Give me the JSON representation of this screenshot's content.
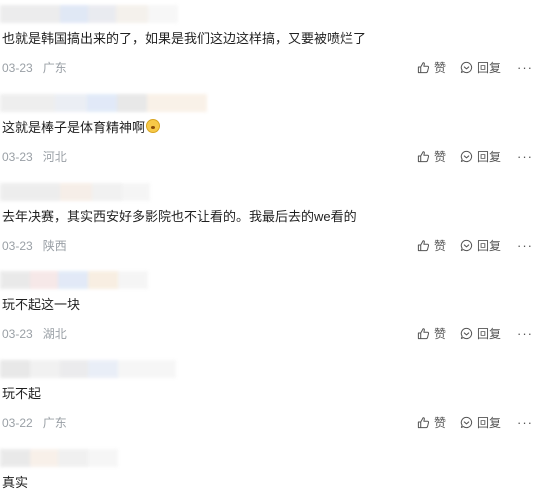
{
  "actions": {
    "like_label": "赞",
    "reply_label": "回复",
    "more_label": "···"
  },
  "comments": [
    {
      "text": "也就是韩国搞出来的了，如果是我们这边这样搞，又要被喷烂了",
      "date": "03-23",
      "location": "广东"
    },
    {
      "text": "这就是棒子是体育精神啊",
      "emoji": "astonished-face-emoji",
      "date": "03-23",
      "location": "河北"
    },
    {
      "text": "去年决赛，其实西安好多影院也不让看的。我最后去的we看的",
      "date": "03-23",
      "location": "陕西"
    },
    {
      "text": "玩不起这一块",
      "date": "03-23",
      "location": "湖北"
    },
    {
      "text": "玩不起",
      "date": "03-22",
      "location": "广东"
    },
    {
      "text": "真实"
    }
  ],
  "colors": {
    "text": "#1f1f1f",
    "meta": "#9aa0a6",
    "action": "#555555"
  }
}
